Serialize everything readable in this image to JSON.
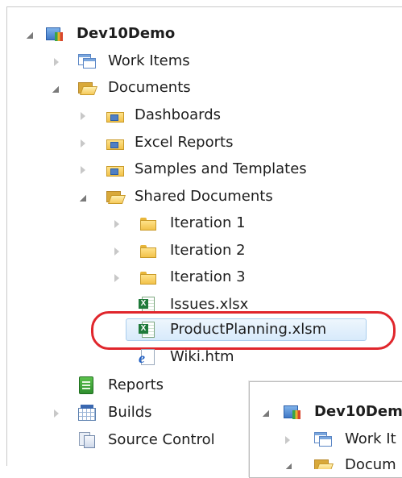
{
  "tree": {
    "root": {
      "label": "Dev10Demo",
      "icon": "team-project-icon"
    },
    "work_items": {
      "label": "Work Items",
      "icon": "work-items-icon"
    },
    "documents": {
      "label": "Documents",
      "icon": "folder-open-icon"
    },
    "dashboards": {
      "label": "Dashboards",
      "icon": "document-library-icon"
    },
    "excel_reports": {
      "label": "Excel Reports",
      "icon": "document-library-icon"
    },
    "samples": {
      "label": "Samples and Templates",
      "icon": "document-library-icon"
    },
    "shared_docs": {
      "label": "Shared Documents",
      "icon": "folder-open-icon"
    },
    "iteration1": {
      "label": "Iteration 1",
      "icon": "folder-icon"
    },
    "iteration2": {
      "label": "Iteration 2",
      "icon": "folder-icon"
    },
    "iteration3": {
      "label": "Iteration 3",
      "icon": "folder-icon"
    },
    "issues": {
      "label": "Issues.xlsx",
      "icon": "excel-file-icon"
    },
    "product_planning": {
      "label": "ProductPlanning.xlsm",
      "icon": "excel-file-icon",
      "selected": true
    },
    "wiki": {
      "label": "Wiki.htm",
      "icon": "html-file-icon"
    },
    "reports": {
      "label": "Reports",
      "icon": "reports-icon"
    },
    "builds": {
      "label": "Builds",
      "icon": "builds-icon"
    },
    "source_control": {
      "label": "Source Control",
      "icon": "source-control-icon"
    }
  },
  "overlay_panel": {
    "root_label": "Dev10Dem",
    "work_items_label": "Work It",
    "documents_label": "Docum"
  },
  "colors": {
    "highlight_annotation": "#e0262c",
    "selection_fill": "#d7eafb",
    "selection_border": "#a9cdee"
  }
}
